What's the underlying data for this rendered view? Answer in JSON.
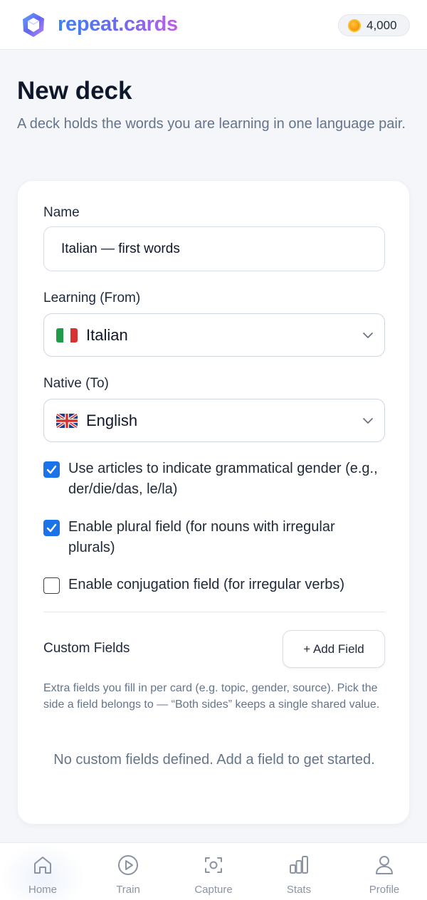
{
  "header": {
    "brand": "repeat.cards",
    "coins": "4,000",
    "logo_icon": "cube-logo-icon",
    "coin_icon": "coin-icon"
  },
  "page": {
    "title": "New deck",
    "subtitle": "A deck holds the words you are learning in one language pair."
  },
  "form": {
    "name_label": "Name",
    "name_value": "Italian — first words",
    "learning_label": "Learning (From)",
    "learning_value": "Italian",
    "learning_flag": "italy-flag-icon",
    "native_label": "Native (To)",
    "native_value": "English",
    "native_flag": "uk-flag-icon",
    "options": [
      {
        "label": "Use articles to indicate grammatical gender (e.g., der/die/das, le/la)",
        "checked": true
      },
      {
        "label": "Enable plural field (for nouns with irregular plurals)",
        "checked": true
      },
      {
        "label": "Enable conjugation field (for irregular verbs)",
        "checked": false
      }
    ]
  },
  "custom_fields": {
    "title": "Custom Fields",
    "add_button": "+ Add Field",
    "help": "Extra fields you fill in per card (e.g. topic, gender, source). Pick the side a field belongs to — “Both sides” keeps a single shared value.",
    "empty": "No custom fields defined. Add a field to get started."
  },
  "nav": {
    "items": [
      {
        "label": "Home",
        "icon": "home-icon",
        "active": true
      },
      {
        "label": "Train",
        "icon": "play-icon",
        "active": false
      },
      {
        "label": "Capture",
        "icon": "capture-icon",
        "active": false
      },
      {
        "label": "Stats",
        "icon": "stats-icon",
        "active": false
      },
      {
        "label": "Profile",
        "icon": "profile-icon",
        "active": false
      }
    ]
  },
  "colors": {
    "accent": "#1a73e8",
    "brand_start": "#3b82f6",
    "brand_end": "#c05ee6"
  }
}
